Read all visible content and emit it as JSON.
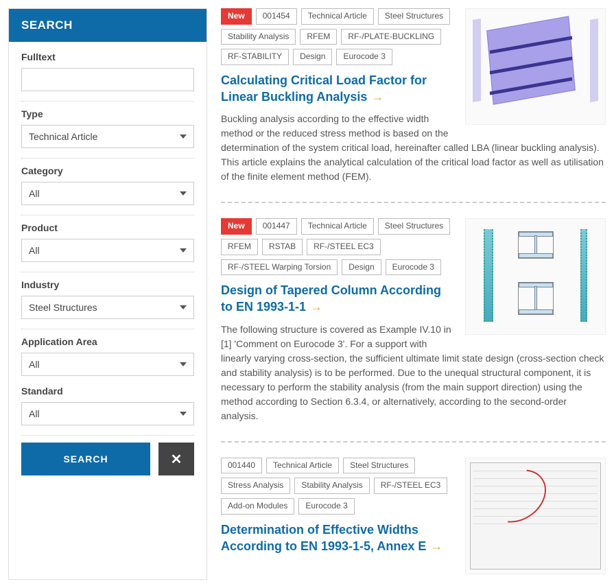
{
  "sidebar": {
    "header": "SEARCH",
    "fulltext_label": "Fulltext",
    "fulltext_value": "",
    "type_label": "Type",
    "type_value": "Technical Article",
    "category_label": "Category",
    "category_value": "All",
    "product_label": "Product",
    "product_value": "All",
    "industry_label": "Industry",
    "industry_value": "Steel Structures",
    "apparea_label": "Application Area",
    "apparea_value": "All",
    "standard_label": "Standard",
    "standard_value": "All",
    "search_btn": "SEARCH",
    "clear_btn": "✕"
  },
  "articles": [
    {
      "tags": [
        {
          "label": "New",
          "new": true
        },
        {
          "label": "001454"
        },
        {
          "label": "Technical Article"
        },
        {
          "label": "Steel Structures"
        },
        {
          "label": "Stability Analysis"
        },
        {
          "label": "RFEM"
        },
        {
          "label": "RF-/PLATE-BUCKLING"
        },
        {
          "label": "RF-STABILITY"
        },
        {
          "label": "Design"
        },
        {
          "label": "Eurocode 3"
        }
      ],
      "title": "Calculating Critical Load Factor for Linear Buckling Analysis",
      "desc": "Buckling analysis according to the effective width method or the reduced stress method is based on the determination of the system critical load, hereinafter called LBA (linear buckling analysis). This article explains the analytical calculation of the critical load factor as well as utilisation of the finite element method (FEM).",
      "thumb": "plate"
    },
    {
      "tags": [
        {
          "label": "New",
          "new": true
        },
        {
          "label": "001447"
        },
        {
          "label": "Technical Article"
        },
        {
          "label": "Steel Structures"
        },
        {
          "label": "RFEM"
        },
        {
          "label": "RSTAB"
        },
        {
          "label": "RF-/STEEL EC3"
        },
        {
          "label": "RF-/STEEL Warping Torsion"
        },
        {
          "label": "Design"
        },
        {
          "label": "Eurocode 3"
        }
      ],
      "title": "Design of Tapered Column According to EN 1993-1-1",
      "desc": "The following structure is covered as Example IV.10 in [1] 'Comment on Eurocode 3'. For a support with linearly varying cross-section, the sufficient ultimate limit state design (cross-section check and stability analysis) is to be performed. Due to the unequal structural component, it is necessary to perform the stability analysis (from the main support direction) using the method according to Section 6.3.4, or alternatively, according to the second-order analysis.",
      "thumb": "column"
    },
    {
      "tags": [
        {
          "label": "001440"
        },
        {
          "label": "Technical Article"
        },
        {
          "label": "Steel Structures"
        },
        {
          "label": "Stress Analysis"
        },
        {
          "label": "Stability Analysis"
        },
        {
          "label": "RF-/STEEL EC3"
        },
        {
          "label": "Add-on Modules"
        },
        {
          "label": "Eurocode 3"
        }
      ],
      "title": "Determination of Effective Widths According to EN 1993-1-5, Annex E",
      "desc": "",
      "thumb": "dialog"
    }
  ]
}
